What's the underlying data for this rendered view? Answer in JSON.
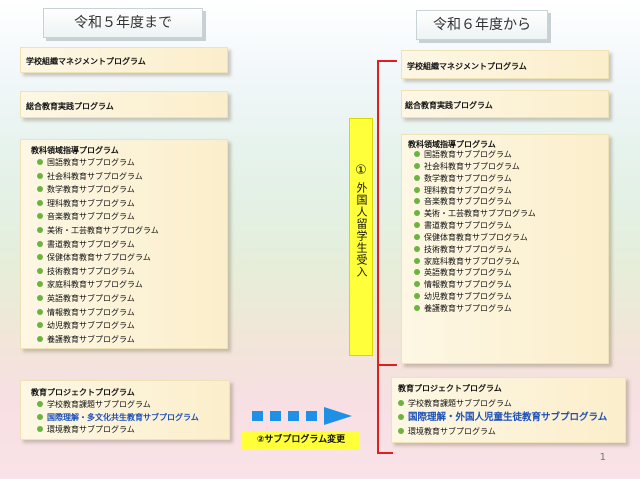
{
  "left": {
    "header": "令和５年度まで",
    "box1": "学校組織マネジメントプログラム",
    "box2": "総合教育実践プログラム",
    "box3": {
      "title": "教科領域指導プログラム",
      "items": [
        "国語教育サブプログラム",
        "社会科教育サブプログラム",
        "数学教育サブプログラム",
        "理科教育サブプログラム",
        "音楽教育サブプログラム",
        "美術・工芸教育サブプログラム",
        "書道教育サブプログラム",
        "保健体育教育サブプログラム",
        "技術教育サブプログラム",
        "家庭科教育サブプログラム",
        "英語教育サブプログラム",
        "情報教育サブプログラム",
        "幼児教育サブプログラム",
        "養護教育サブプログラム"
      ]
    },
    "box4": {
      "title": "教育プロジェクトプログラム",
      "items": [
        "学校教育課題サブプログラム",
        "国際理解・多文化共生教育サブプログラム",
        "環境教育サブプログラム"
      ]
    }
  },
  "right": {
    "header": "令和６年度から",
    "box1": "学校組織マネジメントプログラム",
    "box2": "総合教育実践プログラム",
    "box3": {
      "title": "教科領域指導プログラム",
      "items": [
        "国語教育サブプログラム",
        "社会科教育サブプログラム",
        "数学教育サブプログラム",
        "理科教育サブプログラム",
        "音楽教育サブプログラム",
        "美術・工芸教育サブプログラム",
        "書道教育サブプログラム",
        "保健体育教育サブプログラム",
        "技術教育サブプログラム",
        "家庭科教育サブプログラム",
        "英語教育サブプログラム",
        "情報教育サブプログラム",
        "幼児教育サブプログラム",
        "養護教育サブプログラム"
      ]
    },
    "box4": {
      "title": "教育プロジェクトプログラム",
      "items": [
        "学校教育課題サブプログラム",
        "国際理解・外国人児童生徒教育サブプログラム",
        "環境教育サブプログラム"
      ]
    }
  },
  "notes": {
    "foreign_num": "①",
    "foreign_text": "外国人留学生受入",
    "change": "②サブプログラム変更"
  },
  "colors": {
    "dot": "#6cb33f",
    "highlight": "#1c4fb8",
    "arrow": "#1e90e6",
    "bracket": "#e02020",
    "note_bg": "#ffff3a"
  },
  "page_number": "1"
}
